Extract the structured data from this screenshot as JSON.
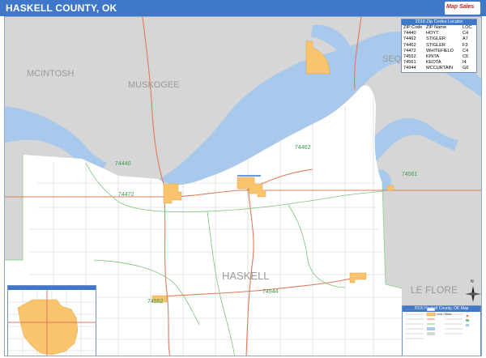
{
  "title": "HASKELL COUNTY, OK",
  "logo_text": "Map Sales",
  "counties": {
    "mcintosh": "MCINTOSH",
    "muskogee": "MUSKOGEE",
    "sequoyah_partial": "SEQ",
    "haskell": "HASKELL",
    "le_flore": "LE FLORE"
  },
  "zip_labels": {
    "z74462": "74462",
    "z74440": "74440",
    "z74472": "74472",
    "z74561": "74561",
    "z74944": "74944",
    "z74552": "74552"
  },
  "zip_locator": {
    "heading": "2016 Zip Codes Locator",
    "columns": [
      "ZIP Code",
      "ZIP Name",
      "LOC"
    ],
    "rows": [
      [
        "74440",
        "HOYT",
        "C4"
      ],
      [
        "74462",
        "STIGLER",
        "A7"
      ],
      [
        "74462",
        "STIGLER",
        "F3"
      ],
      [
        "74472",
        "WHITEFIELD",
        "C4"
      ],
      [
        "74552",
        "KINTA",
        "C5"
      ],
      [
        "74561",
        "KEOTA",
        "I4"
      ],
      [
        "74944",
        "MCCURTAIN",
        "G6"
      ]
    ]
  },
  "legend": {
    "title": "2016 Haskell County, OK Map",
    "subtitle": "Zip and Cities"
  },
  "compass_label": "N",
  "colors": {
    "title_bar": "#3f77c9",
    "water": "#a9c9ec",
    "city": "#f9c46b",
    "county_fill": "#d3d3d3",
    "road_red": "#e07a5f",
    "zip_line": "#7cc47c"
  }
}
